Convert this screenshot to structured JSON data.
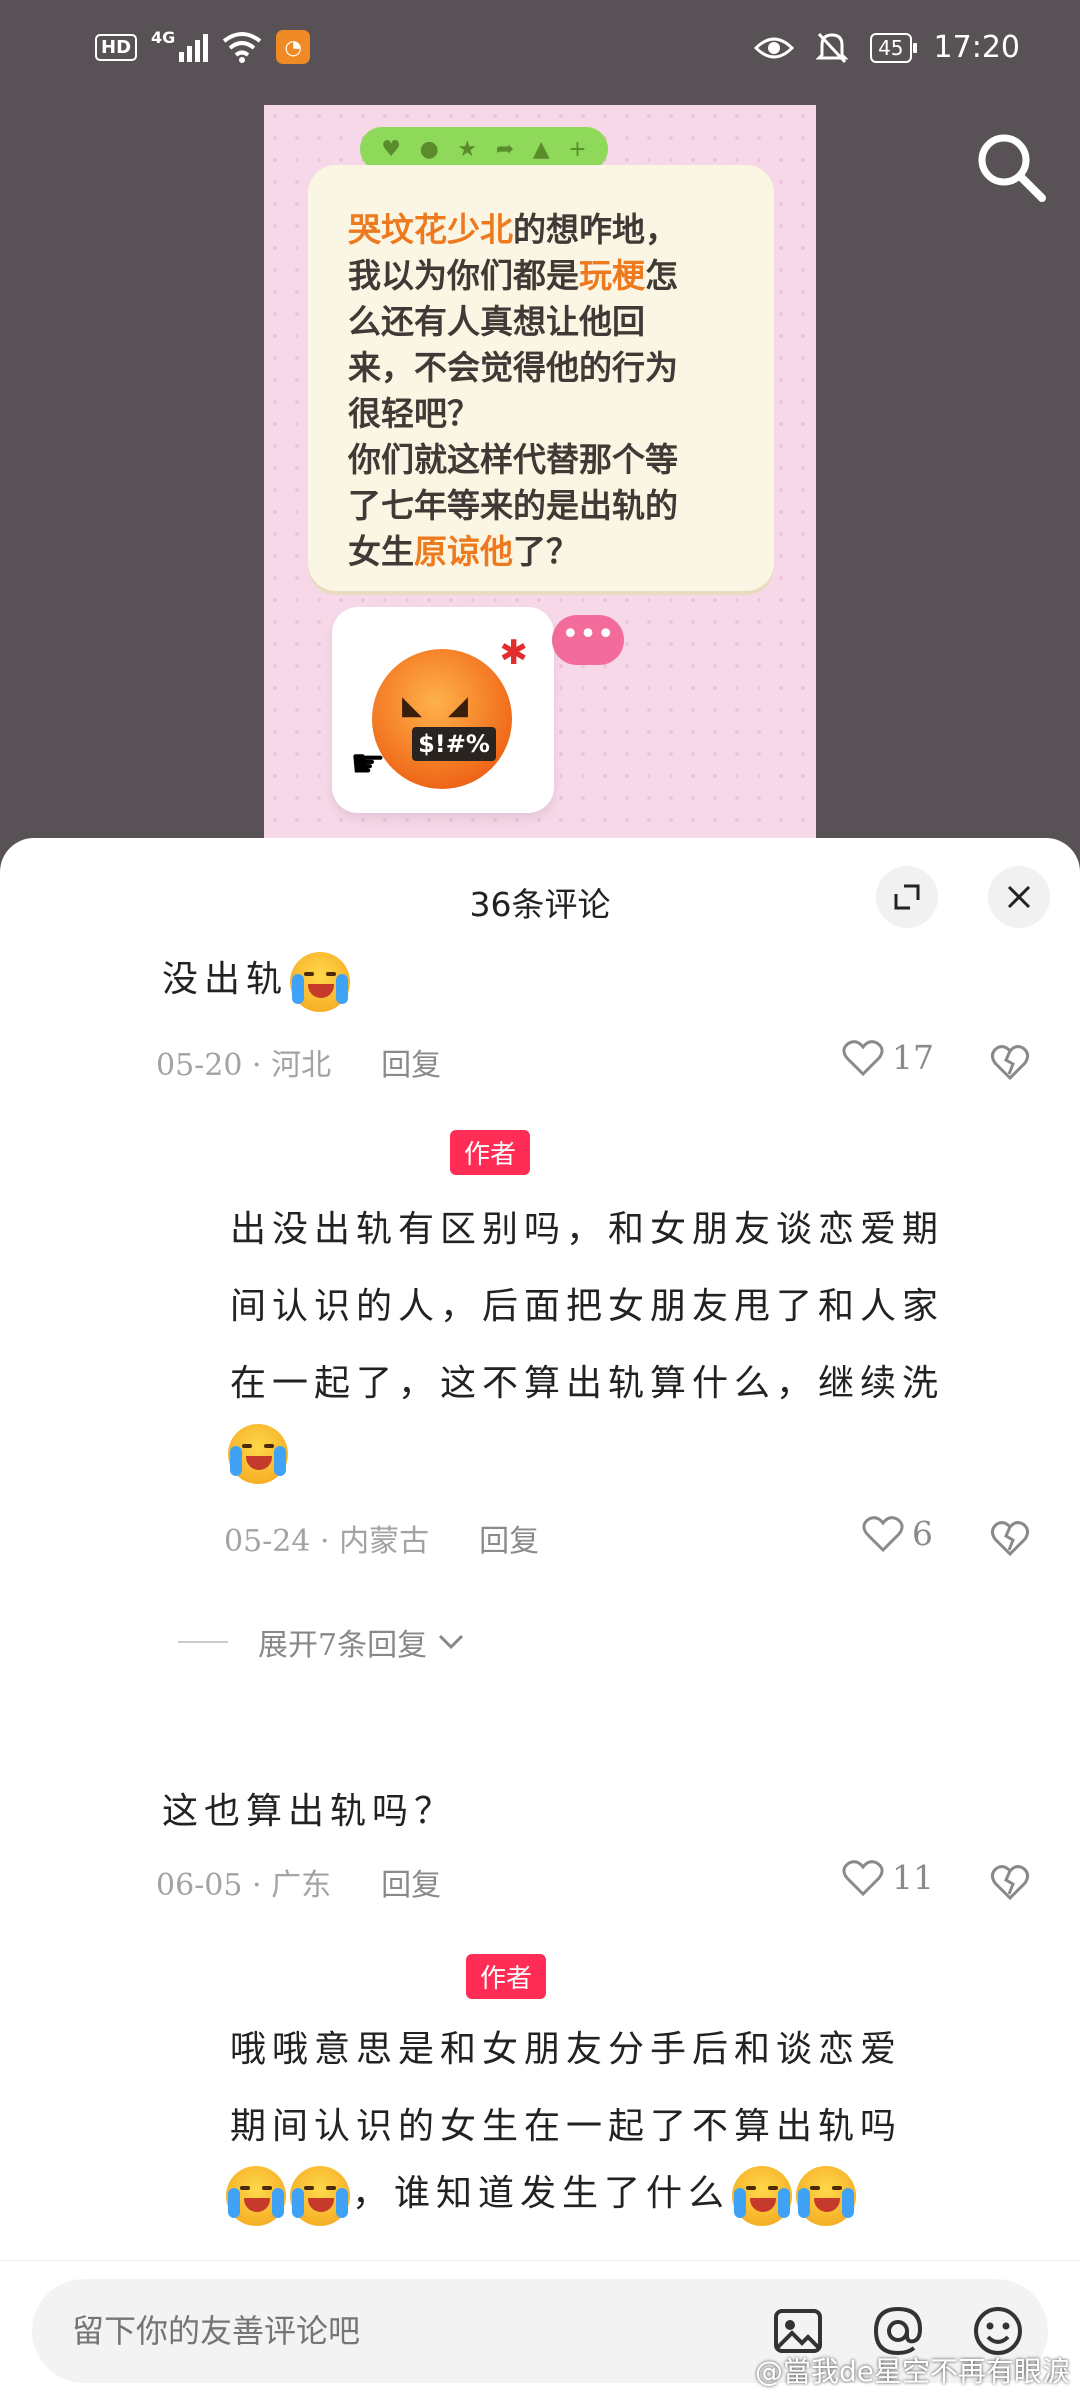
{
  "status_bar": {
    "hd": "HD",
    "network": "4G",
    "battery": "45",
    "time": "17:20"
  },
  "post_image": {
    "line1_pre": "",
    "line1_highlight": "哭坟花少北",
    "line1_post": "的想咋地，",
    "line2_pre": "我以为你们都是",
    "line2_highlight": "玩梗",
    "line2_post": "怎",
    "line3": "么还有人真想让他回",
    "line4": "来，不会觉得他的行为",
    "line5": "很轻吧？",
    "line6": "你们就这样代替那个等",
    "line7": "了七年等来的是出轨的",
    "line8_pre": "女生",
    "line8_highlight": "原谅他",
    "line8_post": "了？",
    "emoji_mask_text": "$!#%",
    "chat_dots": "•••"
  },
  "sheet": {
    "title": "36条评论"
  },
  "comments": [
    {
      "text": "没出轨",
      "date_region": "05-20 · 河北",
      "reply": "回复",
      "likes": "17"
    },
    {
      "tag": "作者",
      "line1": "出没出轨有区别吗，和女朋友谈恋爱期",
      "line2": "间认识的人，后面把女朋友甩了和人家",
      "line3": "在一起了，这不算出轨算什么，继续洗",
      "date_region": "05-24 · 内蒙古",
      "reply": "回复",
      "likes": "6"
    },
    {
      "text": "这也算出轨吗？",
      "date_region": "06-05 · 广东",
      "reply": "回复",
      "likes": "11"
    },
    {
      "tag": "作者",
      "line1": "哦哦意思是和女朋友分手后和谈恋爱",
      "line2": "期间认识的女生在一起了不算出轨吗",
      "line3": "，谁知道发生了什么"
    }
  ],
  "expand_replies": "展开7条回复",
  "input": {
    "placeholder": "留下你的友善评论吧"
  },
  "watermark": "@當我de星空不再有眼淚",
  "colors": {
    "author_tag": "#ff2d55",
    "highlight_orange": "#ed7a1f",
    "pill_green": "#8ed95a"
  }
}
